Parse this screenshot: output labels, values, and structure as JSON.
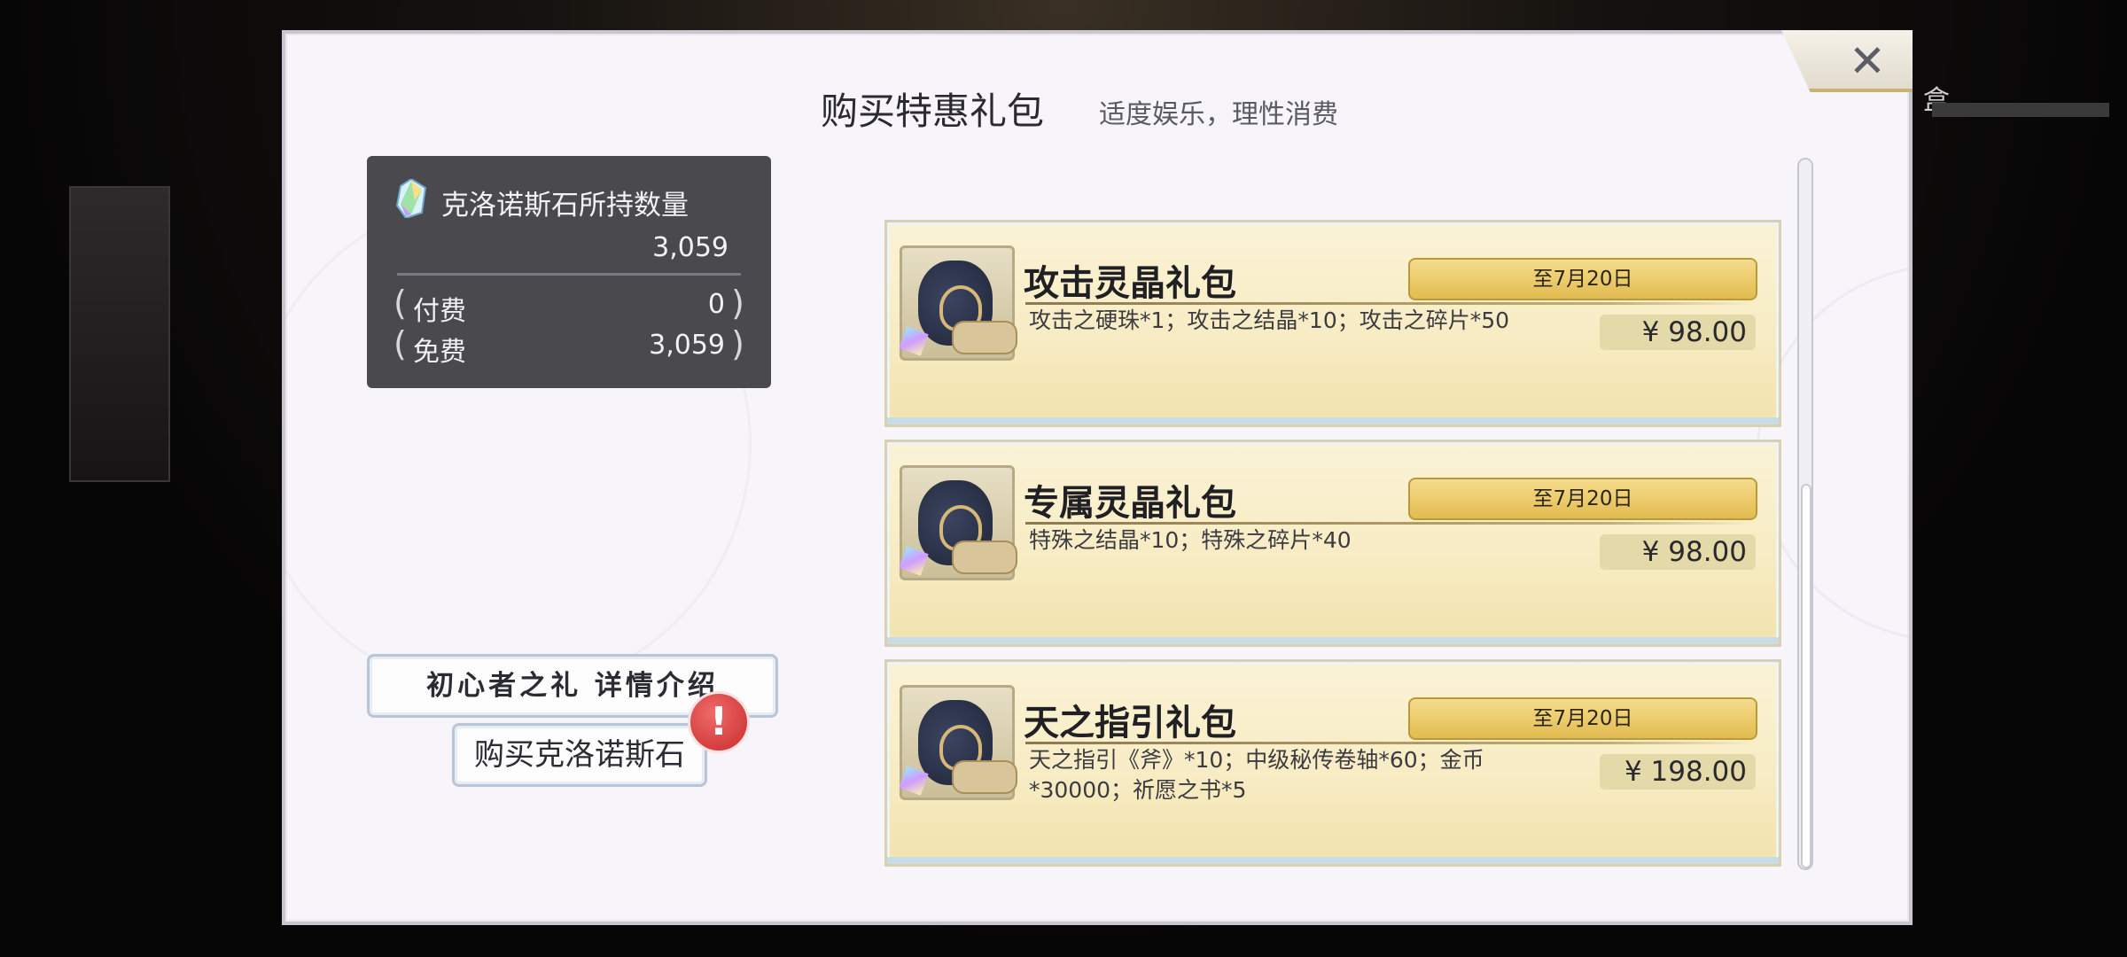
{
  "background": {
    "right_label": "盒"
  },
  "dialog": {
    "title": "购买特惠礼包",
    "subtitle": "适度娱乐，理性消费",
    "close_icon": "close-icon"
  },
  "currency": {
    "label": "克洛诺斯石所持数量",
    "total": "3,059",
    "paid_label": "付费",
    "paid_value": "0",
    "free_label": "免费",
    "free_value": "3,059",
    "paren_open": "(",
    "paren_close": ")"
  },
  "buttons": {
    "newbie_details": "初心者之礼 详情介绍",
    "buy_stone": "购买克洛诺斯石",
    "alert": "!"
  },
  "packs": [
    {
      "name": "攻击灵晶礼包",
      "deadline": "至7月20日",
      "description": "攻击之硬珠*1；攻击之结晶*10；攻击之碎片*50",
      "price": "¥  98.00"
    },
    {
      "name": "专属灵晶礼包",
      "deadline": "至7月20日",
      "description": "特殊之结晶*10；特殊之碎片*40",
      "price": "¥  98.00"
    },
    {
      "name": "天之指引礼包",
      "deadline": "至7月20日",
      "description": "天之指引《斧》*10；中级秘传卷轴*60；金币*30000；祈愿之书*5",
      "price": "¥  198.00"
    }
  ],
  "scroll": {
    "position_fraction": 0.46
  },
  "colors": {
    "card_bg": "#f7ecc4",
    "deadline_gold": "#e1bb4f",
    "panel_dark": "#4a4a4e",
    "alert_red": "#c72c2c"
  }
}
